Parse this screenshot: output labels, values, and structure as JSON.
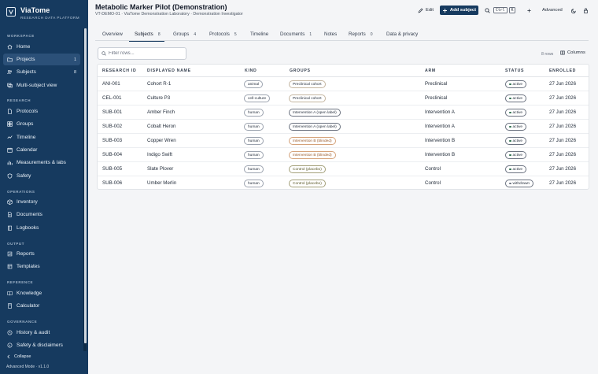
{
  "brand": {
    "name": "ViaTome",
    "subtitle": "RESEARCH DATA PLATFORM"
  },
  "sidebar": {
    "sections": {
      "workspace": "WORKSPACE",
      "research": "RESEARCH",
      "operations": "OPERATIONS",
      "output": "OUTPUT",
      "reference": "REFERENCE",
      "governance": "GOVERNANCE"
    },
    "items": {
      "home": {
        "label": "Home",
        "icon": "home-icon"
      },
      "projects": {
        "label": "Projects",
        "count": "1",
        "icon": "folder-icon"
      },
      "subjects": {
        "label": "Subjects",
        "count": "8",
        "icon": "subjects-icon"
      },
      "multi_subject": {
        "label": "Multi-subject view",
        "icon": "layers-icon"
      },
      "protocols": {
        "label": "Protocols",
        "icon": "document-icon"
      },
      "groups": {
        "label": "Groups",
        "icon": "groups-icon"
      },
      "timeline": {
        "label": "Timeline",
        "icon": "timeline-icon"
      },
      "calendar": {
        "label": "Calendar",
        "icon": "calendar-icon"
      },
      "measurements": {
        "label": "Measurements & labs",
        "icon": "chart-icon"
      },
      "safety": {
        "label": "Safety",
        "icon": "shield-icon"
      },
      "inventory": {
        "label": "Inventory",
        "icon": "box-icon"
      },
      "documents": {
        "label": "Documents",
        "icon": "documents-icon"
      },
      "logbooks": {
        "label": "Logbooks",
        "icon": "book-icon"
      },
      "reports": {
        "label": "Reports",
        "icon": "report-icon"
      },
      "templates": {
        "label": "Templates",
        "icon": "template-icon"
      },
      "knowledge": {
        "label": "Knowledge",
        "icon": "knowledge-icon"
      },
      "calculator": {
        "label": "Calculator",
        "icon": "calculator-icon"
      },
      "history": {
        "label": "History & audit",
        "icon": "history-icon"
      },
      "disclaimers": {
        "label": "Safety & disclaimers",
        "icon": "info-icon"
      }
    },
    "collapse_label": "Collapse",
    "version": "Advanced Mode · v1.1.0"
  },
  "header": {
    "title": "Metabolic Marker Pilot (Demonstration)",
    "subtitle": "VT-DEMO-01 · ViaTome Demonstration Laboratory · Demonstration Investigator",
    "edit_label": "Edit",
    "add_subject_label": "Add subject",
    "kbd_ctrl": "Ctrl",
    "kbd_k": "K",
    "advanced_label": "Advanced"
  },
  "tabs": [
    {
      "label": "Overview",
      "count": ""
    },
    {
      "label": "Subjects",
      "count": "8"
    },
    {
      "label": "Groups",
      "count": "4"
    },
    {
      "label": "Protocols",
      "count": "5"
    },
    {
      "label": "Timeline",
      "count": ""
    },
    {
      "label": "Documents",
      "count": "1"
    },
    {
      "label": "Notes",
      "count": ""
    },
    {
      "label": "Reports",
      "count": "0"
    },
    {
      "label": "Data & privacy",
      "count": ""
    }
  ],
  "filter": {
    "placeholder": "Filter rows...",
    "value": ""
  },
  "rows_count": "8 rows",
  "columns_label": "Columns",
  "table": {
    "headers": [
      "RESEARCH ID",
      "DISPLAYED NAME",
      "KIND",
      "GROUPS",
      "ARM",
      "STATUS",
      "ENROLLED"
    ],
    "rows": [
      {
        "id": "ANI-001",
        "name": "Cohort R-1",
        "kind": "animal",
        "group": "Preclinical cohort",
        "arm": "Preclinical",
        "status": "active",
        "enrolled": "27 Jun 2026"
      },
      {
        "id": "CEL-001",
        "name": "Culture P3",
        "kind": "cell-culture",
        "group": "Preclinical cohort",
        "arm": "Preclinical",
        "status": "active",
        "enrolled": "27 Jun 2026"
      },
      {
        "id": "SUB-001",
        "name": "Amber Finch",
        "kind": "human",
        "group": "Intervention A (open label)",
        "arm": "Intervention A",
        "status": "active",
        "enrolled": "27 Jun 2026"
      },
      {
        "id": "SUB-002",
        "name": "Cobalt Heron",
        "kind": "human",
        "group": "Intervention A (open label)",
        "arm": "Intervention A",
        "status": "active",
        "enrolled": "27 Jun 2026"
      },
      {
        "id": "SUB-003",
        "name": "Copper Wren",
        "kind": "human",
        "group": "Intervention B (blinded)",
        "arm": "Intervention B",
        "status": "active",
        "enrolled": "27 Jun 2026"
      },
      {
        "id": "SUB-004",
        "name": "Indigo Swift",
        "kind": "human",
        "group": "Intervention B (blinded)",
        "arm": "Intervention B",
        "status": "active",
        "enrolled": "27 Jun 2026"
      },
      {
        "id": "SUB-005",
        "name": "Slate Plover",
        "kind": "human",
        "group": "Control (placebo)",
        "arm": "Control",
        "status": "active",
        "enrolled": "27 Jun 2026"
      },
      {
        "id": "SUB-006",
        "name": "Umber Merlin",
        "kind": "human",
        "group": "Control (placebo)",
        "arm": "Control",
        "status": "withdrawn",
        "enrolled": "27 Jun 2026"
      }
    ]
  },
  "colors": {
    "sidebar": "#163a5f",
    "accent": "#163a5f",
    "active_dot": "#2f6f4e"
  }
}
